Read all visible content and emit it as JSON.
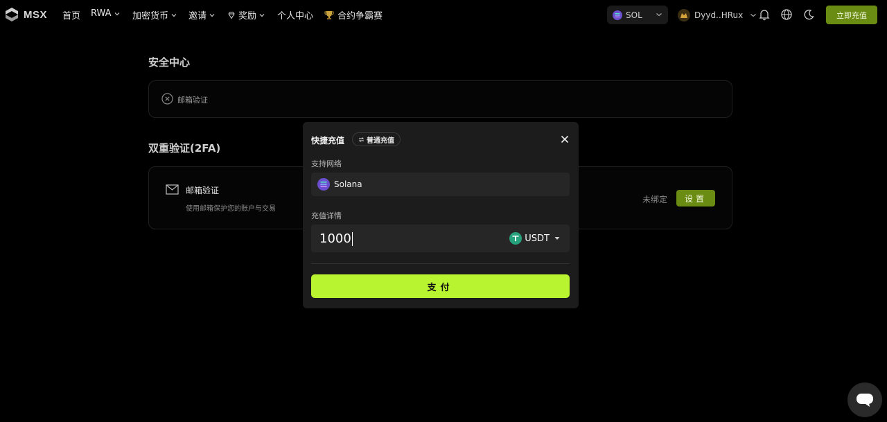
{
  "nav": {
    "logo": "MSX",
    "items": [
      {
        "label": "首页",
        "has_dropdown": false
      },
      {
        "label": "RWA",
        "has_dropdown": true
      },
      {
        "label": "加密货币",
        "has_dropdown": true
      },
      {
        "label": "邀请",
        "has_dropdown": true
      },
      {
        "label": "奖励",
        "has_dropdown": true
      },
      {
        "label": "个人中心",
        "has_dropdown": false
      },
      {
        "label": "合约争霸赛",
        "has_dropdown": false
      }
    ],
    "network": "SOL",
    "account": "Dyyd..HRux",
    "topup_label": "立即充值"
  },
  "security": {
    "title": "安全中心",
    "email_item": "邮箱验证"
  },
  "twofa": {
    "title": "双重验证(2FA)",
    "item_title": "邮箱验证",
    "item_desc": "使用邮箱保护您的账户与交易",
    "status": "未绑定",
    "set_label": "设置"
  },
  "modal": {
    "title": "快捷充值",
    "switch_label": "普通充值",
    "network_label": "支持网络",
    "network_value": "Solana",
    "detail_label": "充值详情",
    "amount": "1000",
    "token": "USDT",
    "pay_label": "支付"
  },
  "colors": {
    "accent": "#b9f431",
    "button_dark_green": "#6a8c12"
  }
}
